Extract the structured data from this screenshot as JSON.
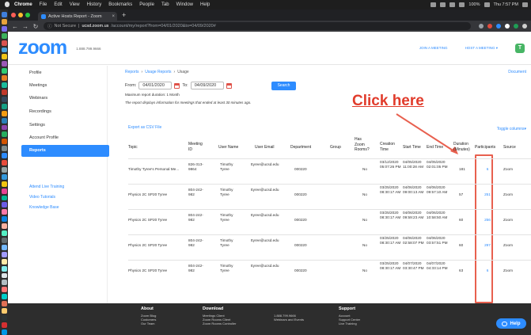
{
  "menubar": {
    "items": [
      "Chrome",
      "File",
      "Edit",
      "View",
      "History",
      "Bookmarks",
      "People",
      "Tab",
      "Window",
      "Help"
    ],
    "battery": "100%",
    "time": "Thu 7:57 PM"
  },
  "browser": {
    "tab_title": "Active Hosts Report - Zoom",
    "new_tab": "+",
    "not_secure": "Not Secure",
    "domain": "ucsd.zoom.us",
    "path": "/account/my/report?from=04/01/2020&to=04/09/2020#"
  },
  "zoom": {
    "logo": "zoom",
    "phone": "1.888.799.9666",
    "join_meeting": "JOIN A MEETING",
    "host_meeting": "HOST A MEETING ▾",
    "avatar": "T"
  },
  "sidebar": {
    "items": [
      "Profile",
      "Meetings",
      "Webinars",
      "Recordings",
      "Settings",
      "Account Profile",
      "Reports"
    ],
    "links": [
      "Attend Live Training",
      "Video Tutorials",
      "Knowledge Base"
    ]
  },
  "report": {
    "breadcrumb": [
      "Reports",
      "›",
      "Usage Reports",
      "›",
      "Usage"
    ],
    "doc_link": "Document",
    "from_label": "From:",
    "from_value": "04/01/2020",
    "to_label": "To:",
    "to_value": "04/09/2020",
    "search_label": "Search",
    "max_duration": "Maximum report duration: 1 Month",
    "note": "The report displays information for meetings that ended at least 30 minutes ago.",
    "export": "Export as CSV File",
    "toggle": "Toggle columns▾",
    "annotation": "Click here",
    "headers": [
      "Topic",
      "Meeting ID",
      "User Name",
      "User Email",
      "Department",
      "Group",
      "Has Zoom Rooms?",
      "Creation Time",
      "Start Time",
      "End Time",
      "Duration (Minutes)",
      "Participants",
      "Source"
    ],
    "rows": [
      {
        "topic": "Timothy Tyree's Personal Me...",
        "id": "826-313-9864",
        "user": "Timothy Tyree",
        "email": "ttyree@ucsd.edu",
        "dept": "000220",
        "group": "",
        "zr": "No",
        "created": "03/12/2020 05:07:26 PM",
        "start": "04/05/2020 11:00:28 AM",
        "end": "04/05/2020 02:01:05 PM",
        "duration": "181",
        "participants": "6",
        "source": "Zoom"
      },
      {
        "topic": "Physics 2C SP20 Tyree",
        "id": "804-242-982",
        "user": "Timothy Tyree",
        "email": "ttyree@ucsd.edu",
        "dept": "000220",
        "group": "",
        "zr": "No",
        "created": "03/25/2020 08:30:17 AM",
        "start": "04/06/2020 09:00:13 AM",
        "end": "04/06/2020 09:57:10 AM",
        "duration": "57",
        "participants": "251",
        "source": "Zoom"
      },
      {
        "topic": "Physics 2C SP20 Tyree",
        "id": "804-242-982",
        "user": "Timothy Tyree",
        "email": "ttyree@ucsd.edu",
        "dept": "000220",
        "group": "",
        "zr": "No",
        "created": "03/25/2020 08:30:17 AM",
        "start": "04/06/2020 09:59:23 AM",
        "end": "04/06/2020 10:58:50 AM",
        "duration": "60",
        "participants": "256",
        "source": "Zoom"
      },
      {
        "topic": "Physics 2C SP20 Tyree",
        "id": "804-242-982",
        "user": "Timothy Tyree",
        "email": "ttyree@ucsd.edu",
        "dept": "000220",
        "group": "",
        "zr": "No",
        "created": "03/25/2020 08:30:17 AM",
        "start": "04/06/2020 02:58:07 PM",
        "end": "04/06/2020 03:57:51 PM",
        "duration": "60",
        "participants": "297",
        "source": "Zoom"
      },
      {
        "topic": "Physics 2C SP20 Tyree",
        "id": "804-242-982",
        "user": "Timothy Tyree",
        "email": "ttyree@ucsd.edu",
        "dept": "000220",
        "group": "",
        "zr": "No",
        "created": "03/25/2020 08:30:17 AM",
        "start": "04/07/2020 03:30:47 PM",
        "end": "04/07/2020 04:33:14 PM",
        "duration": "63",
        "participants": "6",
        "source": "Zoom"
      }
    ]
  },
  "footer": {
    "about": {
      "title": "About",
      "links": [
        "Zoom Blog",
        "Customers",
        "Our Team"
      ]
    },
    "download": {
      "title": "Download",
      "links": [
        "Meetings Client",
        "Zoom Rooms Client",
        "Zoom Rooms Controller"
      ]
    },
    "contact": {
      "links": [
        "1.888.799.9666",
        "Webinars and Events"
      ]
    },
    "support": {
      "title": "Support",
      "links": [
        "Account",
        "Support Center",
        "Live Training"
      ]
    },
    "help": "Help"
  },
  "colors": {
    "accent": "#2d8cff",
    "annotation": "#e13c2c",
    "active_sidebar": "#2d8cff"
  }
}
